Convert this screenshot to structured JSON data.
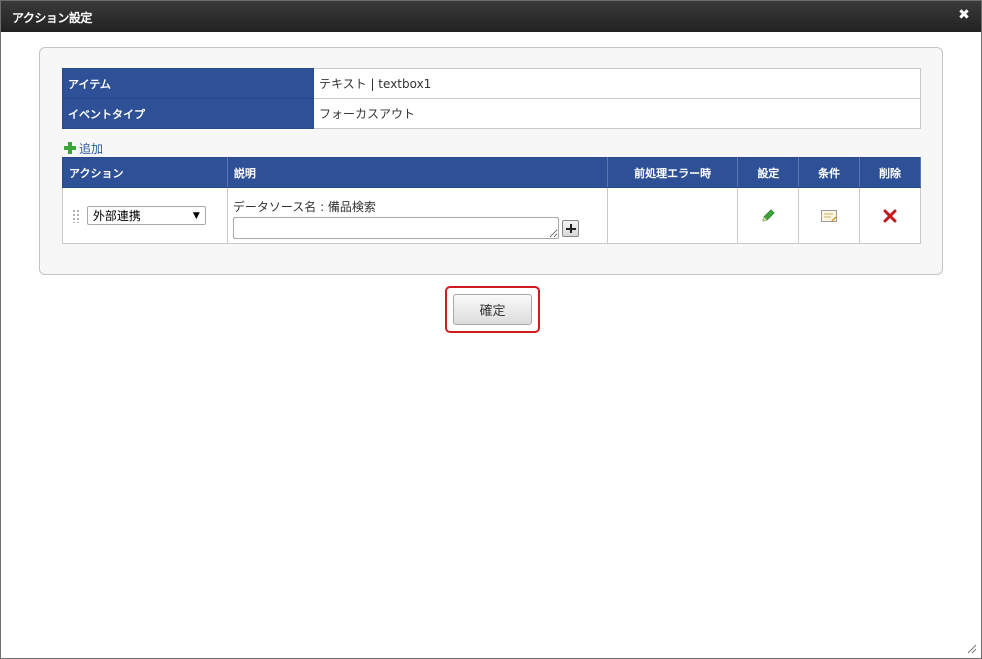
{
  "dialog": {
    "title": "アクション設定",
    "close_label": "✖"
  },
  "info": {
    "rows": [
      {
        "label": "アイテム",
        "value": "テキスト | textbox1"
      },
      {
        "label": "イベントタイプ",
        "value": "フォーカスアウト"
      }
    ]
  },
  "add_label": "追加",
  "actions_table": {
    "headers": {
      "action": "アクション",
      "description": "説明",
      "preprocess_error": "前処理エラー時",
      "settings": "設定",
      "condition": "条件",
      "delete": "削除"
    },
    "rows": [
      {
        "action_value": "外部連携",
        "description_label": "データソース名 : 備品検索",
        "description_text": "",
        "preprocess_error": ""
      }
    ]
  },
  "confirm_label": "確定",
  "colors": {
    "header_bg": "#2d5096",
    "titlebar_bg": "#2b2b2b",
    "highlight_border": "#d01c1c",
    "edit_icon": "#3aa63a",
    "delete_icon": "#c8171c"
  },
  "icons": [
    "close-icon",
    "plus-icon",
    "drag-handle-icon",
    "chevron-down-icon",
    "pencil-icon",
    "note-icon",
    "delete-icon",
    "resize-grip-icon"
  ]
}
